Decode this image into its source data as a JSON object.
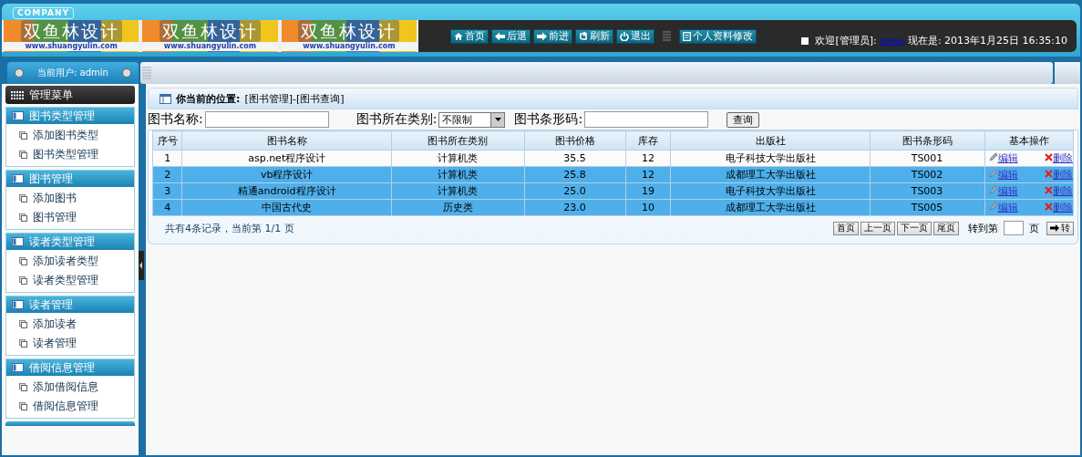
{
  "header": {
    "company": "COMPANY",
    "logos": [
      {
        "name": "双鱼林设计",
        "url": "www.shuangyulin.com"
      },
      {
        "name": "双鱼林设计",
        "url": "www.shuangyulin.com"
      },
      {
        "name": "双鱼林设计",
        "url": "www.shuangyulin.com"
      }
    ],
    "nav": [
      {
        "label": "首页"
      },
      {
        "label": "后退"
      },
      {
        "label": "前进"
      },
      {
        "label": "刷新"
      },
      {
        "label": "退出"
      }
    ],
    "profile_button": "个人资料修改",
    "welcome": "欢迎[管理员]:",
    "user_link": "admin",
    "time": "现在是: 2013年1月25日 16:35:10"
  },
  "user_panel": {
    "label": "当前用户: admin"
  },
  "menu_title": "管理菜单",
  "sidebar": [
    {
      "title": "图书类型管理",
      "items": [
        "添加图书类型",
        "图书类型管理"
      ]
    },
    {
      "title": "图书管理",
      "items": [
        "添加图书",
        "图书管理"
      ]
    },
    {
      "title": "读者类型管理",
      "items": [
        "添加读者类型",
        "读者类型管理"
      ]
    },
    {
      "title": "读者管理",
      "items": [
        "添加读者",
        "读者管理"
      ]
    },
    {
      "title": "借阅信息管理",
      "items": [
        "添加借阅信息",
        "借阅信息管理"
      ]
    }
  ],
  "breadcrumb": {
    "label": "你当前的位置:",
    "path": "[图书管理]-[图书查询]"
  },
  "search": {
    "name_label": "图书名称:",
    "category_label": "图书所在类别:",
    "category_value": "不限制",
    "barcode_label": "图书条形码:",
    "button": "查询"
  },
  "table": {
    "columns": [
      "序号",
      "图书名称",
      "图书所在类别",
      "图书价格",
      "库存",
      "出版社",
      "图书条形码",
      "基本操作"
    ],
    "rows": [
      {
        "cells": [
          "1",
          "asp.net程序设计",
          "计算机类",
          "35.5",
          "12",
          "电子科技大学出版社",
          "TS001"
        ],
        "selected": false,
        "edit": "编辑",
        "delete": "删除"
      },
      {
        "cells": [
          "2",
          "vb程序设计",
          "计算机类",
          "25.8",
          "12",
          "成都理工大学出版社",
          "TS002"
        ],
        "selected": true,
        "edit": "编辑",
        "delete": "删除"
      },
      {
        "cells": [
          "3",
          "精通android程序设计",
          "计算机类",
          "25.0",
          "19",
          "电子科技大学出版社",
          "TS003"
        ],
        "selected": true,
        "edit": "编辑",
        "delete": "删除"
      },
      {
        "cells": [
          "4",
          "中国古代史",
          "历史类",
          "23.0",
          "10",
          "成都理工大学出版社",
          "TS005"
        ],
        "selected": true,
        "edit": "编辑",
        "delete": "删除"
      }
    ]
  },
  "pager": {
    "summary": "共有4条记录，当前第 1/1 页",
    "buttons": [
      "首页",
      "上一页",
      "下一页",
      "尾页"
    ],
    "goto_label": "转到第",
    "page_suffix": "页",
    "go_button": "转"
  }
}
